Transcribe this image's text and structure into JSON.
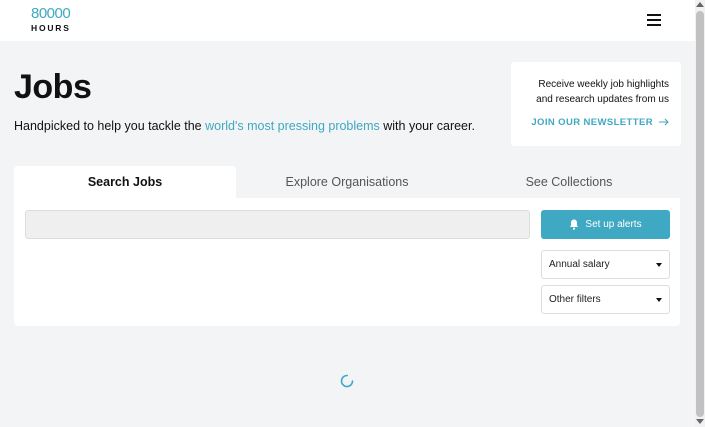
{
  "header": {
    "logo_number": "80000",
    "logo_word": "HOURS",
    "menu_icon": "hamburger-menu-icon"
  },
  "page": {
    "title": "Jobs",
    "tagline_prefix": "Handpicked to help you tackle the ",
    "tagline_link": "world's most pressing problems",
    "tagline_suffix": " with your career."
  },
  "newsletter": {
    "text": "Receive weekly job highlights and research updates from us",
    "link_label": "JOIN OUR NEWSLETTER",
    "link_icon": "arrow-right-icon"
  },
  "tabs": [
    {
      "label": "Search Jobs",
      "active": true
    },
    {
      "label": "Explore Organisations",
      "active": false
    },
    {
      "label": "See Collections",
      "active": false
    }
  ],
  "search": {
    "value": "",
    "placeholder": ""
  },
  "alerts_button": {
    "label": "Set up alerts",
    "icon": "bell-icon"
  },
  "filters": [
    {
      "label": "Annual salary",
      "icon": "caret-down-icon"
    },
    {
      "label": "Other filters",
      "icon": "caret-down-icon"
    }
  ],
  "colors": {
    "accent": "#3fa8c2",
    "background": "#f3f4f6",
    "panel": "#ffffff"
  }
}
